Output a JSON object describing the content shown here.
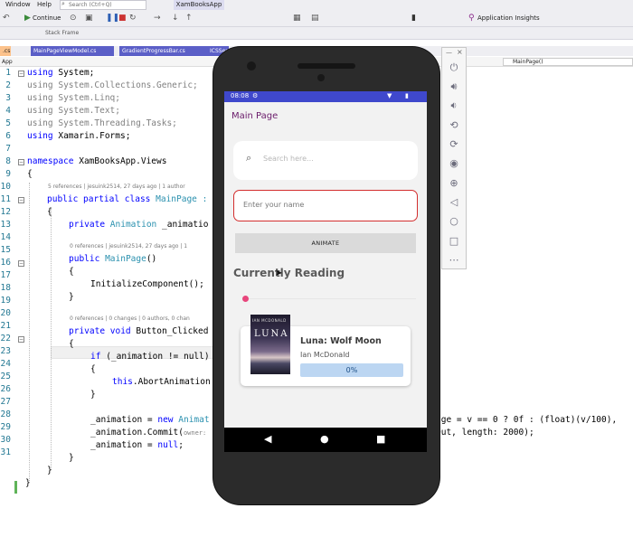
{
  "vs": {
    "menu": {
      "window": "Window",
      "help": "Help"
    },
    "search_placeholder": "Search (Ctrl+Q)",
    "app_title": "XamBooksApp",
    "toolbar": {
      "continue": "Continue",
      "insights": "Application Insights"
    },
    "stack_frame": "Stack Frame",
    "tabs": [
      {
        "label": ".cs"
      },
      {
        "label": "MainPageViewModel.cs"
      },
      {
        "label": "GradientProgressBar.cs"
      },
      {
        "label": "ICSSer"
      }
    ],
    "nav_left": "App",
    "nav_right": "MainPage()",
    "line_numbers": [
      "1",
      "2",
      "3",
      "4",
      "5",
      "6",
      "7",
      "8",
      "9",
      "10",
      "11",
      "12",
      "13",
      "14",
      "15",
      "16",
      "17",
      "18",
      "19",
      "20",
      "21",
      "22",
      "23",
      "24",
      "25",
      "26",
      "27",
      "28",
      "29",
      "30",
      "31"
    ],
    "lens": {
      "class_lens": "5 references | jesuink2514, 27 days ago | 1 author",
      "field_lens": "0 references | jesuink2514, 27 days ago | 1",
      "method_lens": "0 references | 0 changes | 0 authors, 0 chan"
    },
    "code": {
      "l1": "System;",
      "l2": "System.Collections.Generic;",
      "l3": "System.Linq;",
      "l4": "System.Text;",
      "l5": "System.Threading.Tasks;",
      "l6": "Xamarin.Forms;",
      "l8": "XamBooksApp.Views",
      "l10_kw": "public partial class",
      "l10_name": "MainPage :",
      "l12_kw": "private",
      "l12_type": "Animation",
      "l12_rest": "_animatio",
      "l14_kw": "public",
      "l14_type": "MainPage",
      "l14_rest": "()",
      "l16": "InitializeComponent();",
      "l19_kw": "private void",
      "l19_rest": "Button_Clicked",
      "l21_kw": "if",
      "l21_rest": "(_animation != null)",
      "l23_kw": "this",
      "l23_rest": ".AbortAnimation",
      "l26_a": "_animation = ",
      "l26_kw": "new",
      "l26_type": "Animat",
      "l26_right": "age = v == 0 ? 0f : (float)(v/100),",
      "l27_a": "_animation.Commit(",
      "l27_hint": "owner:",
      "l27_right": "Out, length: 2000);",
      "l28_a": "_animation = ",
      "l28_kw": "null",
      "l28_rest": ";",
      "using": "using",
      "namespace": "namespace"
    }
  },
  "emulator": {
    "status_time": "08:08",
    "page_title": "Main Page",
    "search_placeholder": "Search here...",
    "name_placeholder": "Enter your name",
    "animate_button": "ANIMATE",
    "section_title": "Currently Reading",
    "progress_value": 0,
    "book": {
      "title": "Luna: Wolf Moon",
      "author": "Ian McDonald",
      "progress_label": "0%",
      "cover_author": "IAN MCDONALD",
      "cover_title": "LUNA"
    },
    "colors": {
      "status_bar": "#3f48cc",
      "title_purple": "#6a1b6a",
      "error_border": "#d32f2f",
      "progress_dot": "#e8467c",
      "progress_fill": "#bcd6f2"
    }
  },
  "icons": [
    "search-icon",
    "play-icon",
    "pause-icon",
    "stop-icon",
    "restart-icon",
    "power-icon",
    "volume-up-icon",
    "volume-down-icon",
    "rotate-left-icon",
    "rotate-right-icon",
    "camera-icon",
    "zoom-icon",
    "back-icon",
    "home-icon",
    "overview-icon",
    "more-icon",
    "wifi-icon",
    "battery-icon",
    "settings-icon"
  ]
}
